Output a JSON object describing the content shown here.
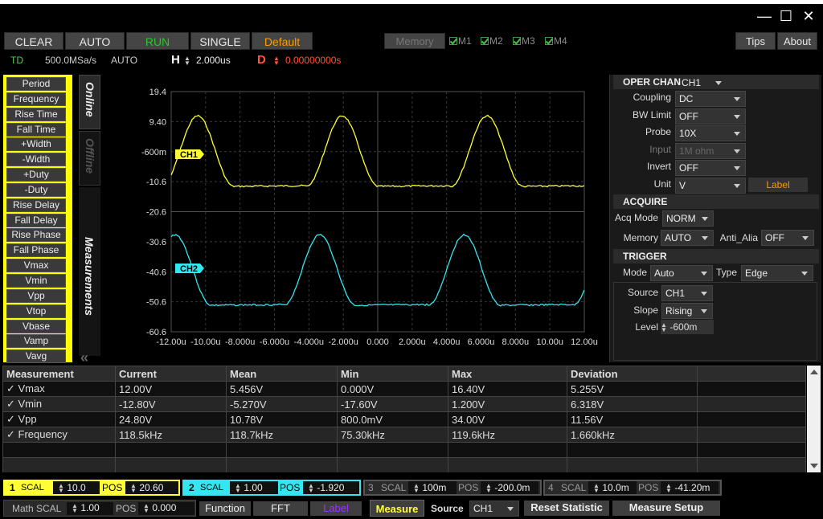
{
  "window": {
    "minimize": "—",
    "maximize": "☐",
    "close": "✕"
  },
  "toolbar": {
    "clear": "CLEAR",
    "auto": "AUTO",
    "run": "RUN",
    "single": "SINGLE",
    "default": "Default",
    "memory": "Memory",
    "m1": "M1",
    "m2": "M2",
    "m3": "M3",
    "m4": "M4",
    "tips": "Tips",
    "about": "About"
  },
  "status": {
    "td": "TD",
    "sample_rate": "500.0MSa/s",
    "mode": "AUTO",
    "h_label": "H",
    "h_value": "2.000us",
    "d_label": "D",
    "d_value": "0.00000000s"
  },
  "measure_list": [
    "Period",
    "Frequency",
    "Rise Time",
    "Fall Time",
    "+Width",
    "-Width",
    "+Duty",
    "-Duty",
    "Rise Delay",
    "Fall Delay",
    "Rise Phase",
    "Fall Phase",
    "Vmax",
    "Vmin",
    "Vpp",
    "Vtop",
    "Vbase",
    "Vamp",
    "Vavg"
  ],
  "tabs": {
    "online": "Online",
    "offline": "Offline",
    "measurements": "Measurements",
    "collapse": "«"
  },
  "colors": {
    "ch1": "#ffff33",
    "ch2": "#33e6f0",
    "default_btn": "#ff9900",
    "run": "#22cc22",
    "d": "#ff5533",
    "label": "#9933ff"
  },
  "scope": {
    "y_ticks": [
      "19.4",
      "9.40",
      "-600m",
      "-10.6",
      "-20.6",
      "-30.6",
      "-40.6",
      "-50.6",
      "-60.6"
    ],
    "x_ticks": [
      "-12.00u",
      "-10.00u",
      "-8.000u",
      "-6.000u",
      "-4.000u",
      "-2.000u",
      "0.000",
      "2.000u",
      "4.000u",
      "6.000u",
      "8.000u",
      "10.00u",
      "12.00u"
    ],
    "ch1_marker": "CH1",
    "ch2_marker": "CH2"
  },
  "oper_chan": {
    "title": "OPER CHAN",
    "channel": "CH1",
    "coupling_label": "Coupling",
    "coupling": "DC",
    "bw_label": "BW Limit",
    "bw": "OFF",
    "probe_label": "Probe",
    "probe": "10X",
    "input_label": "Input",
    "input": "1M ohm",
    "invert_label": "Invert",
    "invert": "OFF",
    "unit_label": "Unit",
    "unit": "V",
    "label_btn": "Label"
  },
  "acquire": {
    "title": "ACQUIRE",
    "acq_mode_label": "Acq Mode",
    "acq_mode": "NORM",
    "memory_label": "Memory",
    "memory": "AUTO",
    "anti_label": "Anti_Alia",
    "anti": "OFF"
  },
  "trigger": {
    "title": "TRIGGER",
    "mode_label": "Mode",
    "mode": "Auto",
    "type_label": "Type",
    "type": "Edge",
    "source_label": "Source",
    "source": "CH1",
    "slope_label": "Slope",
    "slope": "Rising",
    "level_label": "Level",
    "level": "-600m"
  },
  "table": {
    "headers": [
      "Measurement",
      "Current",
      "Mean",
      "Min",
      "Max",
      "Deviation"
    ],
    "rows": [
      [
        "✓  Vmax",
        "12.00V",
        "5.456V",
        "0.000V",
        "16.40V",
        "5.255V"
      ],
      [
        "✓  Vmin",
        "-12.80V",
        "-5.270V",
        "-17.60V",
        "1.200V",
        "6.318V"
      ],
      [
        "✓  Vpp",
        "24.80V",
        "10.78V",
        "800.0mV",
        "34.00V",
        "11.56V"
      ],
      [
        "✓  Frequency",
        "118.5kHz",
        "118.7kHz",
        "75.30kHz",
        "119.6kHz",
        "1.660kHz"
      ]
    ]
  },
  "channels": [
    {
      "num": "1",
      "scal_label": "SCAL",
      "scal": "10.0",
      "pos_label": "POS",
      "pos": "20.60"
    },
    {
      "num": "2",
      "scal_label": "SCAL",
      "scal": "1.00",
      "pos_label": "POS",
      "pos": "-1.920"
    },
    {
      "num": "3",
      "scal_label": "SCAL",
      "scal": "100m",
      "pos_label": "POS",
      "pos": "-200.0m"
    },
    {
      "num": "4",
      "scal_label": "SCAL",
      "scal": "10.0m",
      "pos_label": "POS",
      "pos": "-41.20m"
    }
  ],
  "math": {
    "label": "Math SCAL",
    "scal": "1.00",
    "pos_label": "POS",
    "pos": "0.000",
    "function": "Function",
    "fft": "FFT",
    "label_btn": "Label"
  },
  "bottom": {
    "measure": "Measure",
    "source_label": "Source",
    "source": "CH1",
    "reset": "Reset  Statistic",
    "setup": "Measure  Setup"
  }
}
